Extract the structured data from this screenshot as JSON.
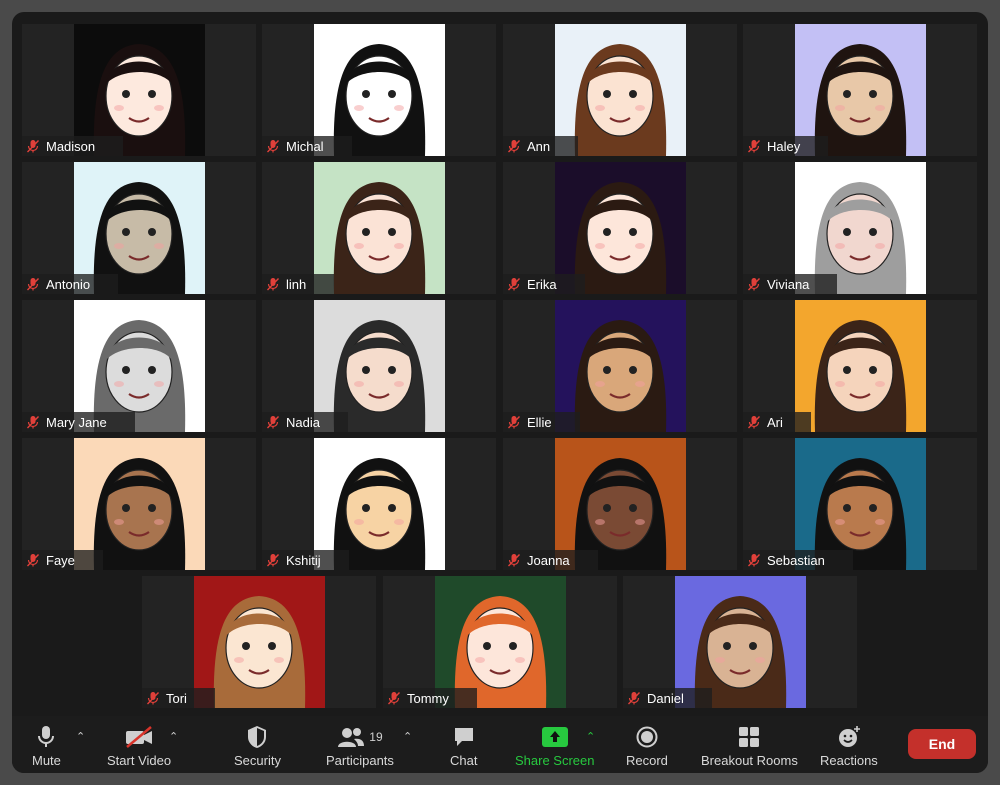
{
  "participants": [
    {
      "name": "Madison",
      "bg": "#0c0c0c",
      "skin": "#fde9de",
      "hair": "#1a0f0f"
    },
    {
      "name": "Michal",
      "bg": "#ffffff",
      "skin": "#ffffff",
      "hair": "#111111"
    },
    {
      "name": "Ann",
      "bg": "#e9f1f8",
      "skin": "#fbe3d2",
      "hair": "#6b3a1e"
    },
    {
      "name": "Haley",
      "bg": "#c3c0f5",
      "skin": "#e8c8a8",
      "hair": "#1f1410"
    },
    {
      "name": "Antonio",
      "bg": "#dff3f8",
      "skin": "#c7bba7",
      "hair": "#111111"
    },
    {
      "name": "linh",
      "bg": "#c5e3c5",
      "skin": "#fbe3d6",
      "hair": "#3b2418"
    },
    {
      "name": "Erika",
      "bg": "#1b0d2a",
      "skin": "#fde6da",
      "hair": "#2b1a12"
    },
    {
      "name": "Viviana",
      "bg": "#ffffff",
      "skin": "#f1d7cf",
      "hair": "#9e9e9e"
    },
    {
      "name": "Mary Jane",
      "bg": "#ffffff",
      "skin": "#dcdcdc",
      "hair": "#6a6a6a"
    },
    {
      "name": "Nadia",
      "bg": "#dcdcdc",
      "skin": "#f5dccc",
      "hair": "#2a2a2a"
    },
    {
      "name": "Ellie",
      "bg": "#24125c",
      "skin": "#d9a77a",
      "hair": "#2a1a12"
    },
    {
      "name": "Ari",
      "bg": "#f3a62d",
      "skin": "#f5d4bc",
      "hair": "#3b2418"
    },
    {
      "name": "Faye",
      "bg": "#fbd9b8",
      "skin": "#a8744f",
      "hair": "#111111"
    },
    {
      "name": "Kshitij",
      "bg": "#ffffff",
      "skin": "#f7d3a4",
      "hair": "#111111"
    },
    {
      "name": "Joanna",
      "bg": "#b8541a",
      "skin": "#7a4a34",
      "hair": "#111111"
    },
    {
      "name": "Sebastian",
      "bg": "#1a6a8a",
      "skin": "#b97a4d",
      "hair": "#111111"
    },
    {
      "name": "Tori",
      "bg": "#a11717",
      "skin": "#fbe6d2",
      "hair": "#a86b3a"
    },
    {
      "name": "Tommy",
      "bg": "#1f4a2a",
      "skin": "#fde6da",
      "hair": "#e0672b"
    },
    {
      "name": "Daniel",
      "bg": "#6a69e0",
      "skin": "#d9b394",
      "hair": "#4a2a18"
    }
  ],
  "toolbar": {
    "mute": "Mute",
    "start_video": "Start Video",
    "security": "Security",
    "participants": "Participants",
    "participants_count": "19",
    "chat": "Chat",
    "share_screen": "Share Screen",
    "record": "Record",
    "breakout_rooms": "Breakout Rooms",
    "reactions": "Reactions",
    "end": "End"
  }
}
